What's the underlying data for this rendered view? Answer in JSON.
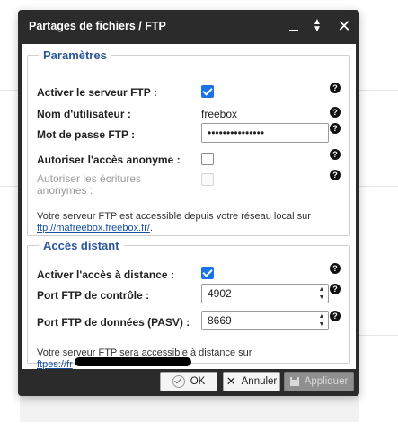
{
  "window": {
    "title": "Partages de fichiers / FTP"
  },
  "parametres": {
    "legend": "Paramètres",
    "ftp_enable_label": "Activer le serveur FTP :",
    "ftp_enable_checked": true,
    "username_label": "Nom d'utilisateur :",
    "username_value": "freebox",
    "password_label": "Mot de passe FTP :",
    "password_value": "•••••••••••••••",
    "anonymous_label": "Autoriser l'accès anonyme :",
    "anonymous_checked": false,
    "anon_write_label_1": "Autoriser les écritures",
    "anon_write_label_2": "anonymes :",
    "note_text": "Votre serveur FTP est accessible depuis votre réseau local sur",
    "note_link": "ftp://mafreebox.freebox.fr/",
    "note_suffix": "."
  },
  "acces_distant": {
    "legend": "Accès distant",
    "remote_label": "Activer l'accès à distance :",
    "remote_checked": true,
    "control_port_label": "Port FTP de contrôle :",
    "control_port_value": "4902",
    "data_port_label": "Port FTP de données (PASV) :",
    "data_port_value": "8669",
    "note_text": "Votre serveur FTP sera accessible à distance sur",
    "note_link_visible": "ftpes://fr"
  },
  "footer": {
    "ok_label": "OK",
    "cancel_label": "Annuler",
    "apply_label": "Appliquer"
  },
  "icons": {
    "help": "?",
    "close": "✕",
    "spin_up": "▲",
    "spin_down": "▼"
  }
}
